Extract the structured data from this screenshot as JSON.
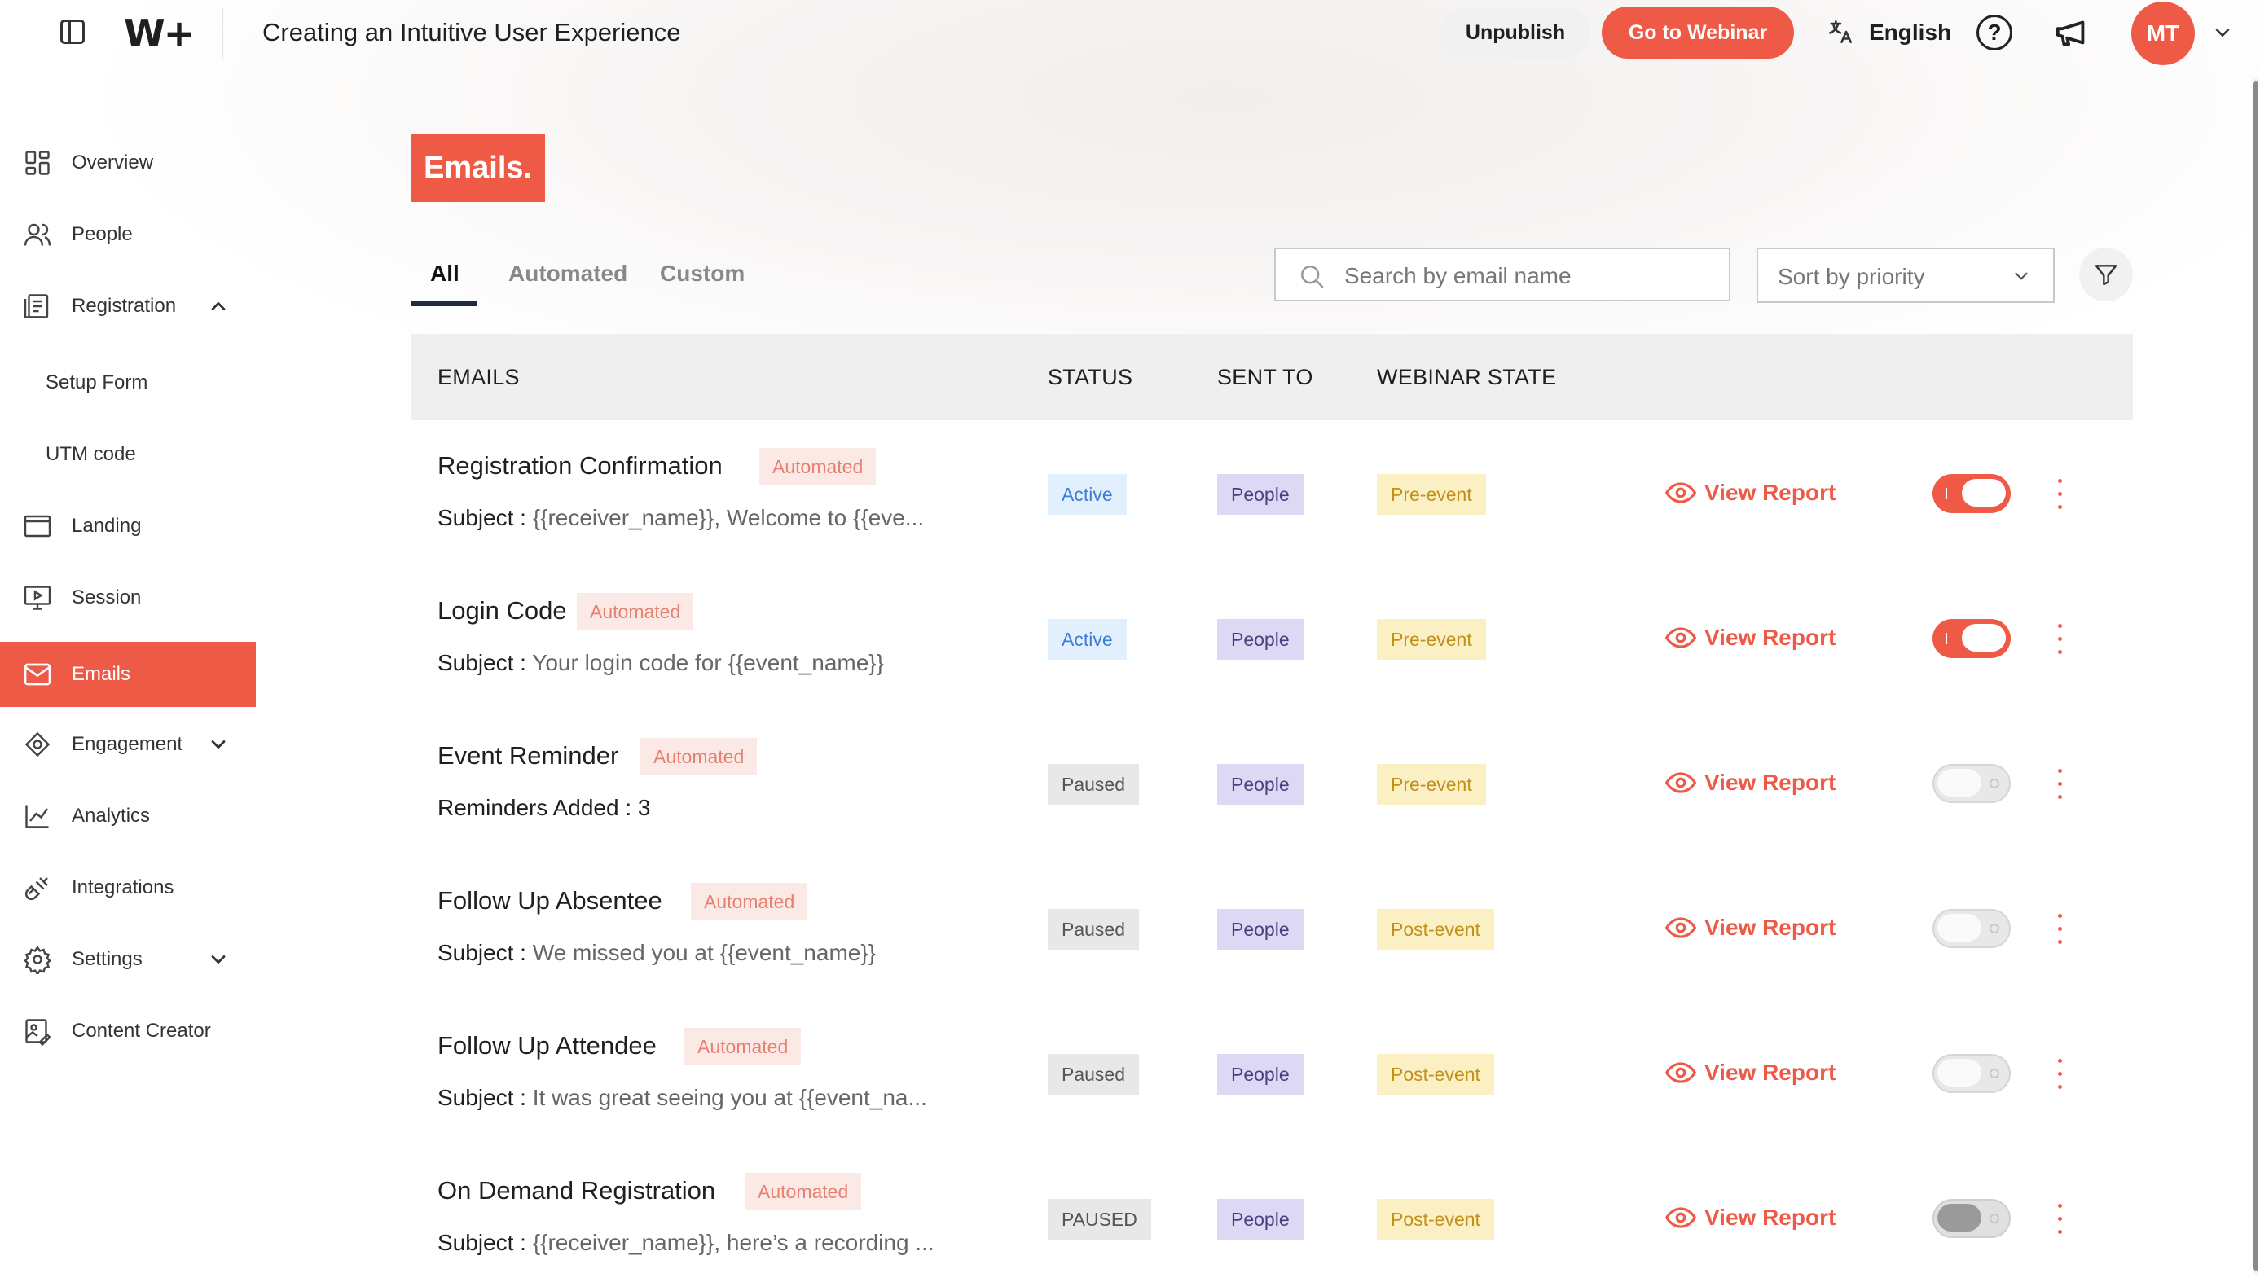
{
  "app": {
    "logo": "W+",
    "title": "Creating an Intuitive User Experience",
    "unpublish_label": "Unpublish",
    "go_to_webinar_label": "Go to Webinar",
    "language": "English",
    "help_glyph": "?",
    "avatar_initials": "MT",
    "accent_color": "#ef5a47"
  },
  "sidebar": {
    "items": [
      {
        "label": "Overview",
        "icon": "grid-icon"
      },
      {
        "label": "People",
        "icon": "people-icon"
      },
      {
        "label": "Registration",
        "icon": "form-icon",
        "expanded": true
      },
      {
        "label": "Setup Form",
        "sub": true
      },
      {
        "label": "UTM code",
        "sub": true
      },
      {
        "label": "Landing",
        "icon": "window-icon"
      },
      {
        "label": "Session",
        "icon": "monitor-play-icon"
      },
      {
        "label": "Emails",
        "icon": "mail-icon",
        "active": true
      },
      {
        "label": "Engagement",
        "icon": "engagement-icon",
        "expanded": false
      },
      {
        "label": "Analytics",
        "icon": "chart-line-icon"
      },
      {
        "label": "Integrations",
        "icon": "plug-icon"
      },
      {
        "label": "Settings",
        "icon": "gear-icon",
        "expanded": false
      },
      {
        "label": "Content Creator",
        "icon": "content-creator-icon"
      }
    ]
  },
  "main": {
    "page_title": "Emails.",
    "tabs": [
      {
        "label": "All",
        "active": true
      },
      {
        "label": "Automated",
        "active": false
      },
      {
        "label": "Custom",
        "active": false
      }
    ],
    "search": {
      "placeholder": "Search by email name"
    },
    "sort": {
      "selected": "Sort by priority"
    },
    "table": {
      "headers": [
        "EMAILS",
        "STATUS",
        "SENT TO",
        "WEBINAR STATE"
      ],
      "view_report_label": "View Report",
      "rows": [
        {
          "name": "Registration Confirmation",
          "type": "Automated",
          "subject_label": "Subject :",
          "subject": "{{receiver_name}}, Welcome to {{eve...",
          "status": "Active",
          "sent_to": "People",
          "state": "Pre-event",
          "enabled": true
        },
        {
          "name": "Login Code",
          "type": "Automated",
          "subject_label": "Subject :",
          "subject": "Your login code for {{event_name}}",
          "status": "Active",
          "sent_to": "People",
          "state": "Pre-event",
          "enabled": true
        },
        {
          "name": "Event Reminder",
          "type": "Automated",
          "subject_label": "Reminders Added :",
          "subject": "3",
          "status": "Paused",
          "sent_to": "People",
          "state": "Pre-event",
          "enabled": false
        },
        {
          "name": "Follow Up Absentee",
          "type": "Automated",
          "subject_label": "Subject :",
          "subject": "We missed you at {{event_name}}",
          "status": "Paused",
          "sent_to": "People",
          "state": "Post-event",
          "enabled": false
        },
        {
          "name": "Follow Up Attendee",
          "type": "Automated",
          "subject_label": "Subject :",
          "subject": "It was great seeing you at {{event_na...",
          "status": "Paused",
          "sent_to": "People",
          "state": "Post-event",
          "enabled": false
        },
        {
          "name": "On Demand Registration",
          "type": "Automated",
          "subject_label": "Subject :",
          "subject": "{{receiver_name}}, here’s a recording ...",
          "status": "PAUSED",
          "sent_to": "People",
          "state": "Post-event",
          "enabled": false
        }
      ]
    }
  }
}
